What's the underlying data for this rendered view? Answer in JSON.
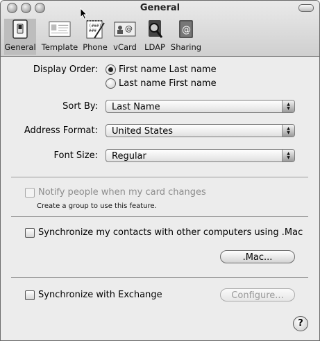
{
  "window": {
    "title": "General"
  },
  "toolbar": {
    "items": [
      {
        "label": "General",
        "icon": "switch-icon",
        "selected": true
      },
      {
        "label": "Template",
        "icon": "template-card-icon",
        "selected": false
      },
      {
        "label": "Phone",
        "icon": "phone-notepad-icon",
        "selected": false
      },
      {
        "label": "vCard",
        "icon": "vcard-icon",
        "selected": false
      },
      {
        "label": "LDAP",
        "icon": "ldap-search-icon",
        "selected": false
      },
      {
        "label": "Sharing",
        "icon": "sharing-address-book-icon",
        "selected": false
      }
    ]
  },
  "display_order": {
    "label": "Display Order:",
    "options": [
      {
        "label": "First name Last name",
        "checked": true
      },
      {
        "label": "Last name First name",
        "checked": false
      }
    ]
  },
  "sort_by": {
    "label": "Sort By:",
    "value": "Last Name"
  },
  "address_format": {
    "label": "Address Format:",
    "value": "United States"
  },
  "font_size": {
    "label": "Font Size:",
    "value": "Regular"
  },
  "notify": {
    "label": "Notify people when my card changes",
    "checked": false,
    "enabled": false,
    "note": "Create a group to use this feature."
  },
  "sync_mac": {
    "label": "Synchronize my contacts with other computers using .Mac",
    "checked": false
  },
  "mac_button": {
    "label": ".Mac..."
  },
  "sync_exchange": {
    "label": "Synchronize with Exchange",
    "checked": false
  },
  "configure_button": {
    "label": "Configure...",
    "enabled": false
  },
  "help": {
    "label": "?"
  }
}
